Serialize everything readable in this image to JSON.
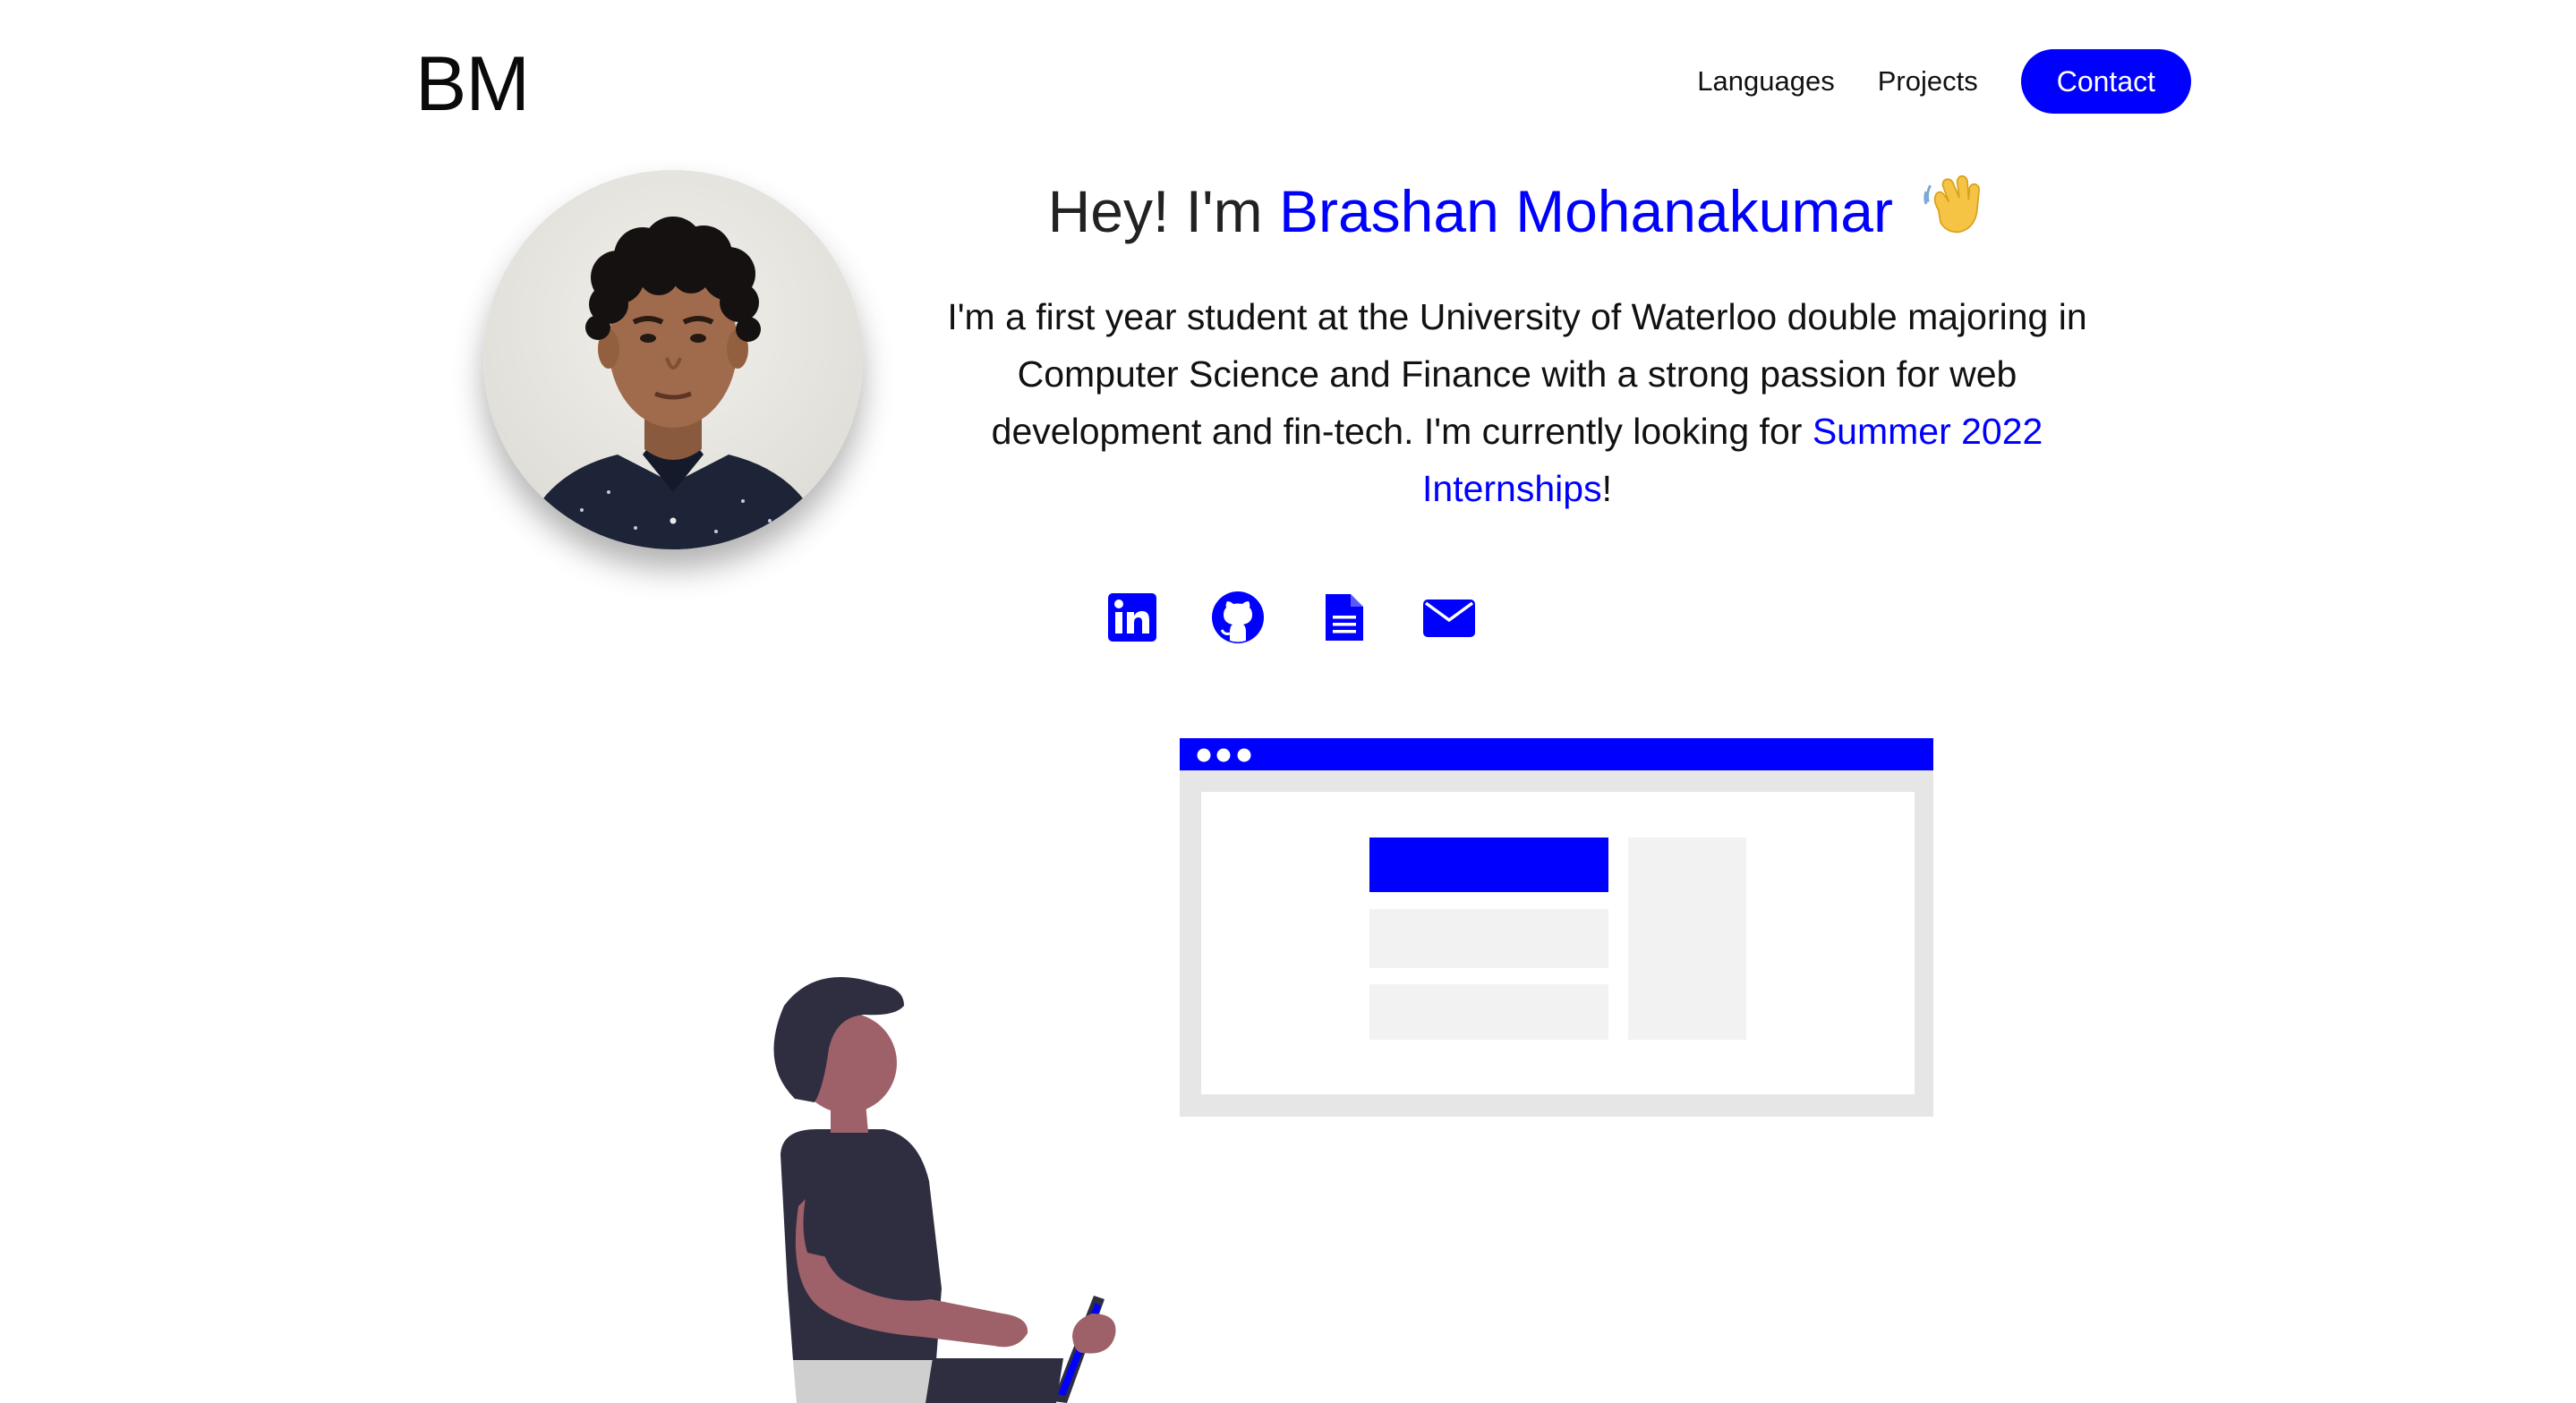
{
  "header": {
    "logo": "BM",
    "nav": {
      "languages": "Languages",
      "projects": "Projects",
      "contact": "Contact"
    }
  },
  "intro": {
    "greeting": "Hey! I'm",
    "name": "Brashan Mohanakumar",
    "bio_text": "I'm a first year student at the University of Waterloo double majoring in Computer Science and Finance with a strong passion for web development and fin-tech. I'm currently looking for",
    "bio_link": "Summer 2022 Internships",
    "bio_end": "!"
  },
  "socials": [
    "linkedin-icon",
    "github-icon",
    "resume-icon",
    "email-icon"
  ],
  "colors": {
    "accent": "#0000ff",
    "text": "#111111",
    "background": "#ffffff"
  }
}
